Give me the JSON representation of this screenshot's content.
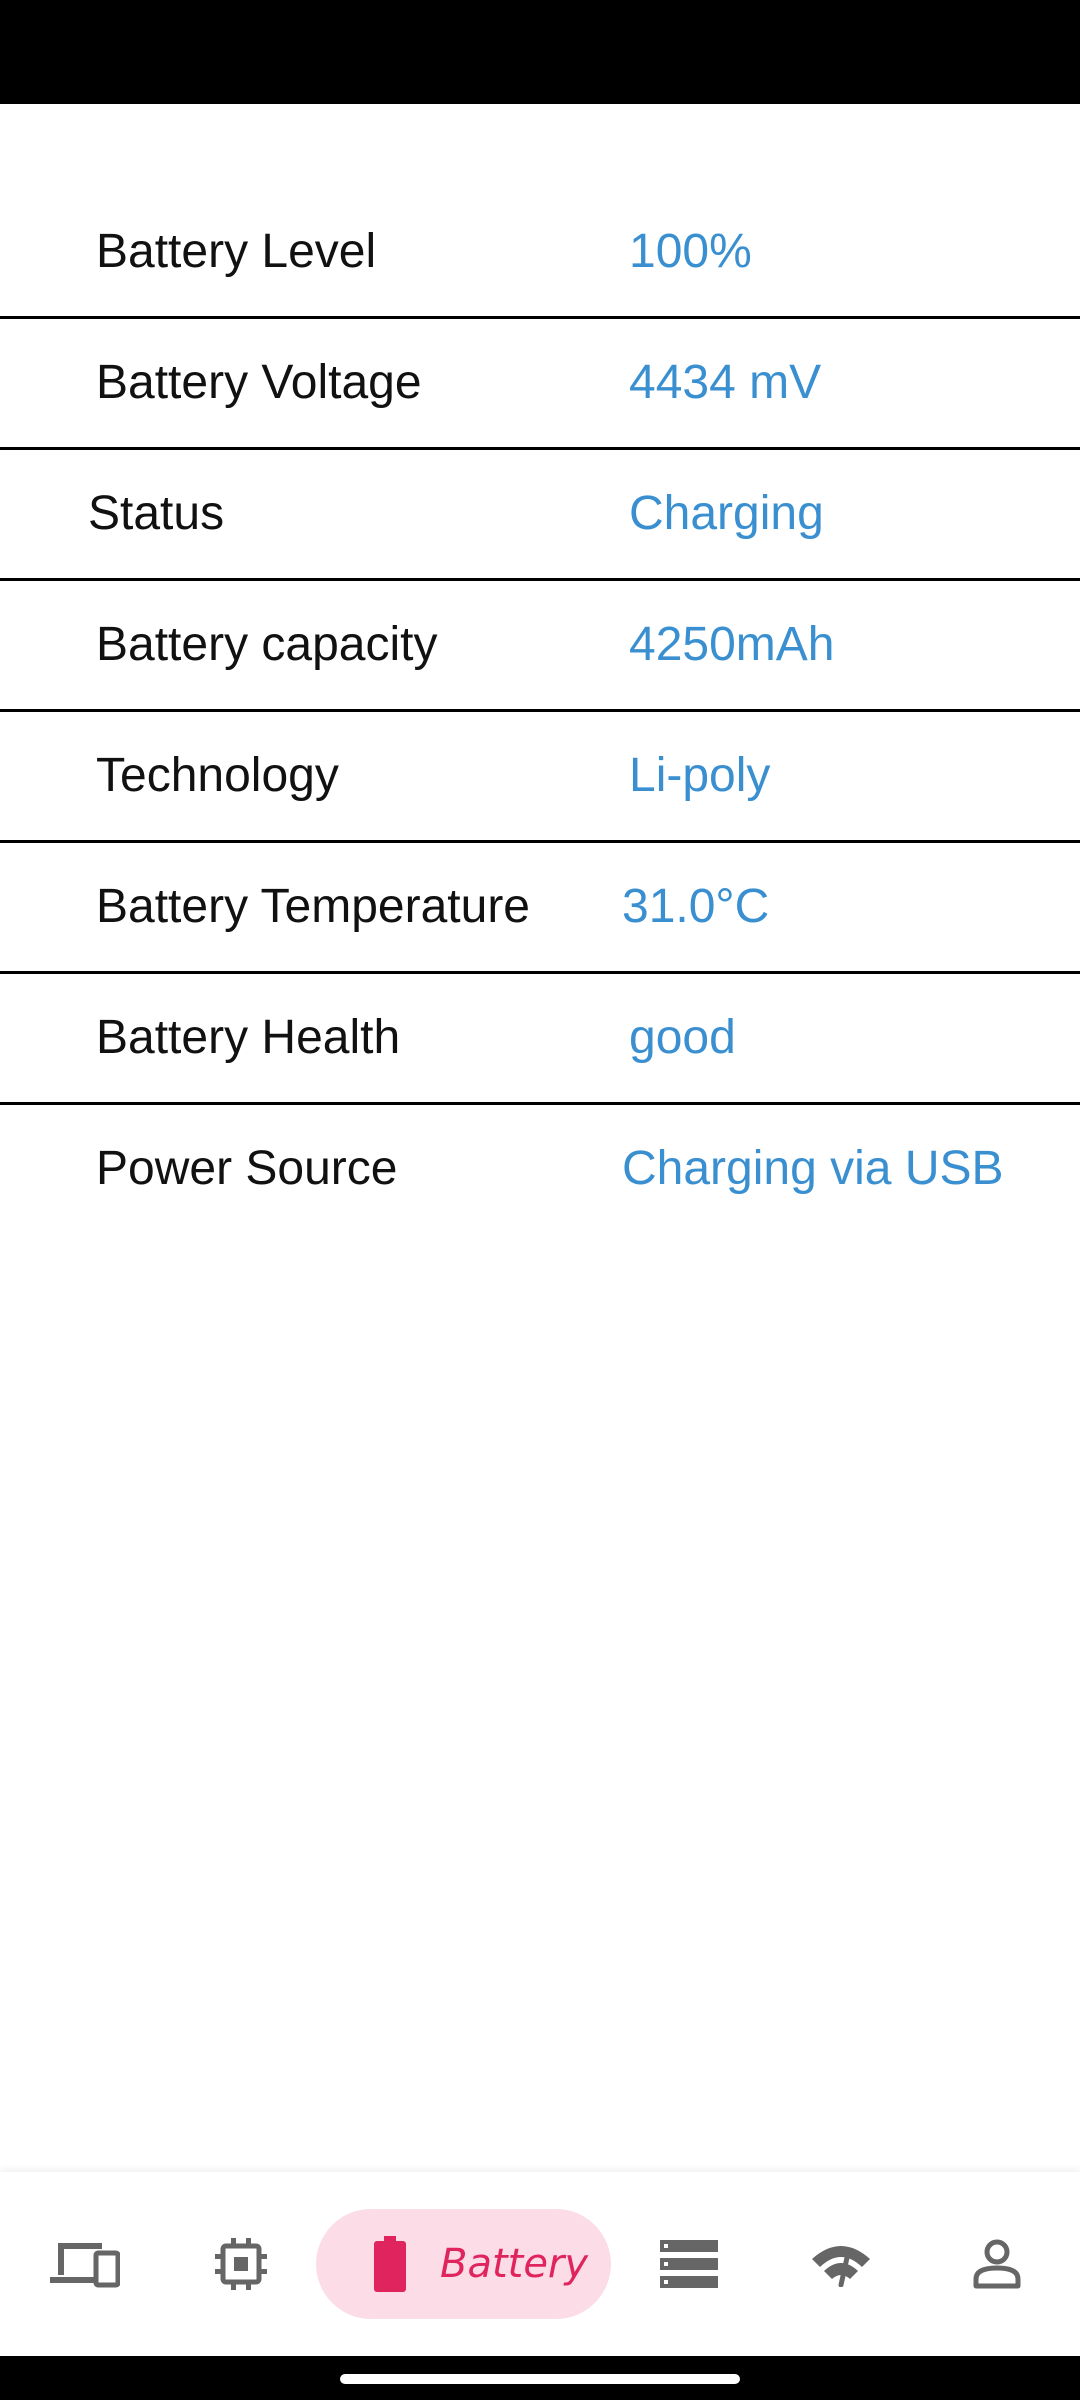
{
  "battery_info": {
    "rows": [
      {
        "label": "Battery Level",
        "value": "100%"
      },
      {
        "label": "Battery Voltage",
        "value": "4434 mV"
      },
      {
        "label": "Status",
        "value": "Charging"
      },
      {
        "label": "Battery capacity",
        "value": "4250mAh"
      },
      {
        "label": "Technology",
        "value": "Li-poly"
      },
      {
        "label": "Battery Temperature",
        "value": "31.0°C"
      },
      {
        "label": "Battery Health",
        "value": "good"
      },
      {
        "label": "Power Source",
        "value": "Charging via USB"
      }
    ]
  },
  "bottom_nav": {
    "items": [
      {
        "icon": "devices-icon",
        "label": ""
      },
      {
        "icon": "cpu-icon",
        "label": ""
      },
      {
        "icon": "battery-icon",
        "label": "Battery",
        "active": true
      },
      {
        "icon": "storage-icon",
        "label": ""
      },
      {
        "icon": "network-icon",
        "label": ""
      },
      {
        "icon": "profile-icon",
        "label": ""
      }
    ]
  },
  "colors": {
    "value_text": "#3a8fd0",
    "active_accent": "#e0245e",
    "active_pill_bg": "#fcdde7",
    "icon_gray": "#666666"
  }
}
